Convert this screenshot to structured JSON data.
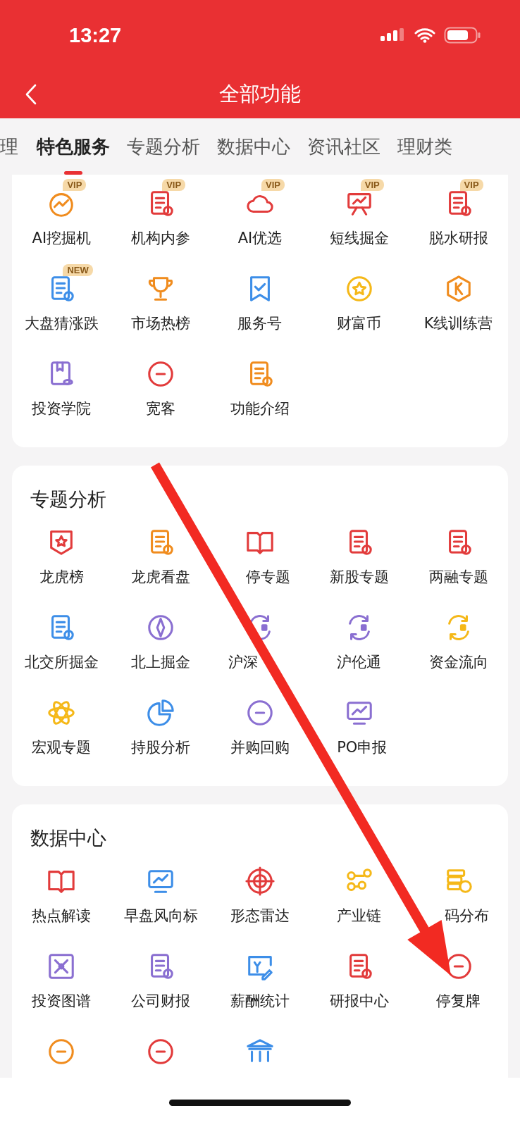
{
  "status_bar": {
    "time": "13:27"
  },
  "header": {
    "title": "全部功能"
  },
  "tabs": [
    {
      "label": "理",
      "selected": false
    },
    {
      "label": "特色服务",
      "selected": true
    },
    {
      "label": "专题分析",
      "selected": false
    },
    {
      "label": "数据中心",
      "selected": false
    },
    {
      "label": "资讯社区",
      "selected": false
    },
    {
      "label": "理财类",
      "selected": false
    }
  ],
  "sections": [
    {
      "items": [
        {
          "label": "AI挖掘机",
          "badge": "VIP",
          "color": "#f08c1e"
        },
        {
          "label": "机构内参",
          "badge": "VIP",
          "color": "#e23b3b"
        },
        {
          "label": "AI优选",
          "badge": "VIP",
          "color": "#e23b3b"
        },
        {
          "label": "短线掘金",
          "badge": "VIP",
          "color": "#e23b3b"
        },
        {
          "label": "脱水研报",
          "badge": "VIP",
          "color": "#e23b3b"
        },
        {
          "label": "大盘猜涨跌",
          "badge": "NEW",
          "color": "#3d8ee8"
        },
        {
          "label": "市场热榜",
          "color": "#f08c1e"
        },
        {
          "label": "服务号",
          "color": "#3d8ee8"
        },
        {
          "label": "财富币",
          "color": "#f5b818"
        },
        {
          "label": "K线训练营",
          "color": "#f08c1e"
        },
        {
          "label": "投资学院",
          "color": "#8a6fd1"
        },
        {
          "label": "宽客",
          "color": "#e23b3b"
        },
        {
          "label": "功能介绍",
          "color": "#f08c1e"
        }
      ]
    },
    {
      "title": "专题分析",
      "items": [
        {
          "label": "龙虎榜",
          "color": "#e23b3b"
        },
        {
          "label": "龙虎看盘",
          "color": "#f08c1e"
        },
        {
          "label": "停专题",
          "color": "#e23b3b"
        },
        {
          "label": "新股专题",
          "color": "#e23b3b"
        },
        {
          "label": "两融专题",
          "color": "#e23b3b"
        },
        {
          "label": "北交所掘金",
          "color": "#3d8ee8"
        },
        {
          "label": "北上掘金",
          "color": "#8a6fd1"
        },
        {
          "label": "沪深",
          "color": "#8a6fd1"
        },
        {
          "label": "沪伦通",
          "color": "#8a6fd1"
        },
        {
          "label": "资金流向",
          "color": "#f5b818"
        },
        {
          "label": "宏观专题",
          "color": "#f5b818"
        },
        {
          "label": "持股分析",
          "color": "#3d8ee8"
        },
        {
          "label": "并购回购",
          "color": "#8a6fd1"
        },
        {
          "label": "PO申报",
          "color": "#8a6fd1"
        }
      ]
    },
    {
      "title": "数据中心",
      "items": [
        {
          "label": "热点解读",
          "color": "#e23b3b"
        },
        {
          "label": "早盘风向标",
          "color": "#3d8ee8"
        },
        {
          "label": "形态雷达",
          "color": "#e23b3b"
        },
        {
          "label": "产业链",
          "color": "#f5b818"
        },
        {
          "label": "码分布",
          "color": "#f5b818"
        },
        {
          "label": "投资图谱",
          "color": "#8a6fd1"
        },
        {
          "label": "公司财报",
          "color": "#8a6fd1"
        },
        {
          "label": "薪酬统计",
          "color": "#3d8ee8"
        },
        {
          "label": "研报中心",
          "color": "#e23b3b"
        },
        {
          "label": "停复牌",
          "color": "#e23b3b"
        },
        {
          "color": "#f08c1e"
        },
        {
          "color": "#e23b3b"
        },
        {
          "color": "#3d8ee8"
        }
      ]
    }
  ]
}
